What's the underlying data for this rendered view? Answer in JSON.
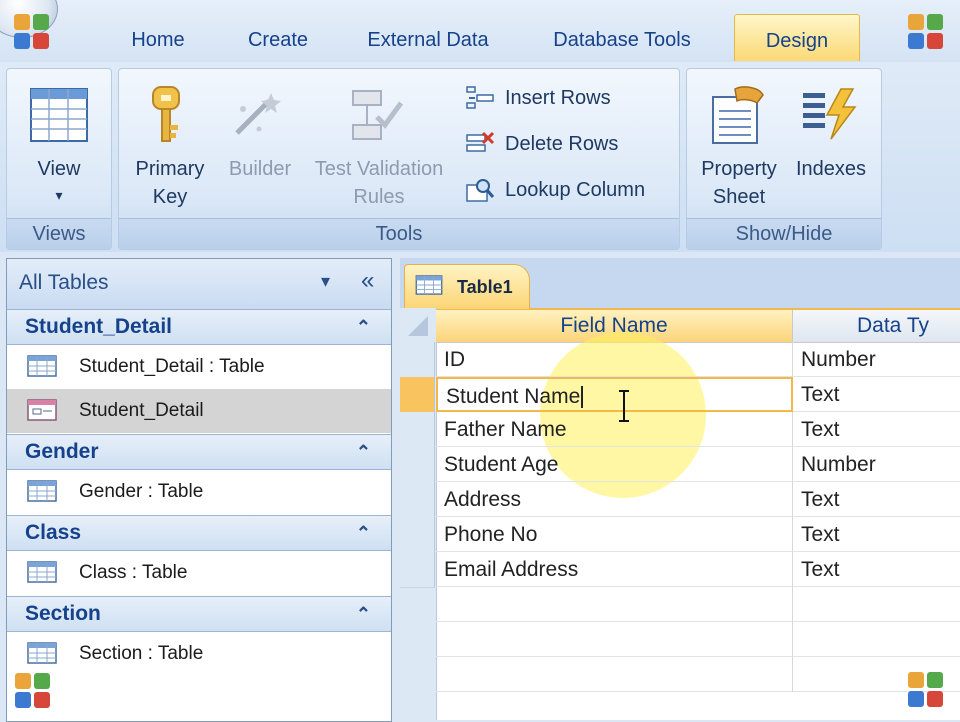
{
  "tabs": [
    "Home",
    "Create",
    "External Data",
    "Database Tools",
    "Design"
  ],
  "active_tab": "Design",
  "ribbon": {
    "views": {
      "group_label": "Views",
      "view_label": "View",
      "view_arrow": "▾"
    },
    "tools": {
      "group_label": "Tools",
      "primary_key": "Primary\nKey",
      "builder": "Builder",
      "test_validation": "Test Validation\nRules",
      "insert_rows": "Insert Rows",
      "delete_rows": "Delete Rows",
      "lookup_column": "Lookup Column"
    },
    "show_hide": {
      "group_label": "Show/Hide",
      "property_sheet": "Property\nSheet",
      "indexes": "Indexes"
    }
  },
  "nav": {
    "title": "All Tables",
    "dropdown_glyph": "▾",
    "shutter_glyph": "«",
    "collapse_glyph": "⌃",
    "groups": [
      {
        "name": "Student_Detail",
        "items": [
          {
            "label": "Student_Detail : Table",
            "icon": "table-icon"
          },
          {
            "label": "Student_Detail",
            "icon": "form-icon"
          }
        ]
      },
      {
        "name": "Gender",
        "items": [
          {
            "label": "Gender : Table",
            "icon": "table-icon"
          }
        ]
      },
      {
        "name": "Class",
        "items": [
          {
            "label": "Class : Table",
            "icon": "table-icon"
          }
        ]
      },
      {
        "name": "Section",
        "items": [
          {
            "label": "Section : Table",
            "icon": "table-icon"
          }
        ]
      }
    ]
  },
  "document": {
    "tab_label": "Table1",
    "columns": [
      "Field Name",
      "Data Ty"
    ],
    "rows": [
      {
        "field": "ID",
        "type": "Number"
      },
      {
        "field": "Student Name",
        "type": "Text"
      },
      {
        "field": "Father Name",
        "type": "Text"
      },
      {
        "field": "Student Age",
        "type": "Number"
      },
      {
        "field": "Address",
        "type": "Text"
      },
      {
        "field": "Phone No",
        "type": "Text"
      },
      {
        "field": "Email Address",
        "type": "Text"
      }
    ],
    "active_row_index": 1
  },
  "colors": {
    "accent": "#f2b94a",
    "ribbon_text": "#15428b",
    "highlight": "#fff27a"
  }
}
